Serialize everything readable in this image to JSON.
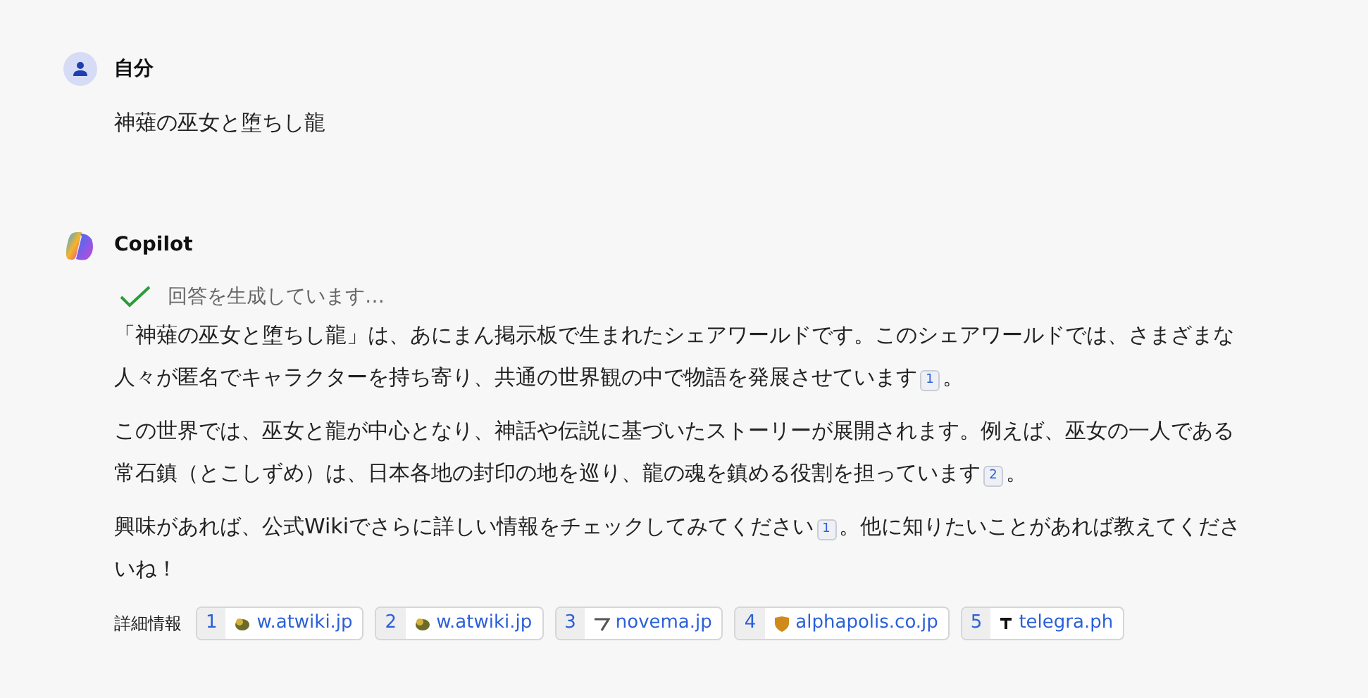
{
  "user": {
    "name": "自分",
    "message": "神薙の巫女と堕ちし龍"
  },
  "assistant": {
    "name": "Copilot",
    "status": "回答を生成しています…",
    "paragraphs": [
      [
        {
          "kind": "text",
          "text": "「神薙の巫女と堕ちし龍」は、あにまん掲示板で生まれたシェアワールドです。このシェアワールドでは、さまざまな人々が匿名でキャラクターを持ち寄り、共通の世界観の中で物語を発展させています"
        },
        {
          "kind": "cite",
          "text": "1"
        },
        {
          "kind": "text",
          "text": "。"
        }
      ],
      [
        {
          "kind": "text",
          "text": "この世界では、巫女と龍が中心となり、神話や伝説に基づいたストーリーが展開されます。例えば、巫女の一人である常石鎮（とこしずめ）は、日本各地の封印の地を巡り、龍の魂を鎮める役割を担っています"
        },
        {
          "kind": "cite",
          "text": "2"
        },
        {
          "kind": "text",
          "text": "。"
        }
      ],
      [
        {
          "kind": "text",
          "text": "興味があれば、公式Wikiでさらに詳しい情報をチェックしてみてください"
        },
        {
          "kind": "cite",
          "text": "1"
        },
        {
          "kind": "text",
          "text": "。他に知りたいことがあれば教えてくださいね！"
        }
      ]
    ],
    "sources_label": "詳細情報",
    "sources": [
      {
        "number": "1",
        "domain": "w.atwiki.jp",
        "kind": "atwiki"
      },
      {
        "number": "2",
        "domain": "w.atwiki.jp",
        "kind": "atwiki"
      },
      {
        "number": "3",
        "domain": "novema.jp",
        "kind": "novema"
      },
      {
        "number": "4",
        "domain": "alphapolis.co.jp",
        "kind": "alphapolis"
      },
      {
        "number": "5",
        "domain": "telegra.ph",
        "kind": "telegraph"
      }
    ]
  }
}
